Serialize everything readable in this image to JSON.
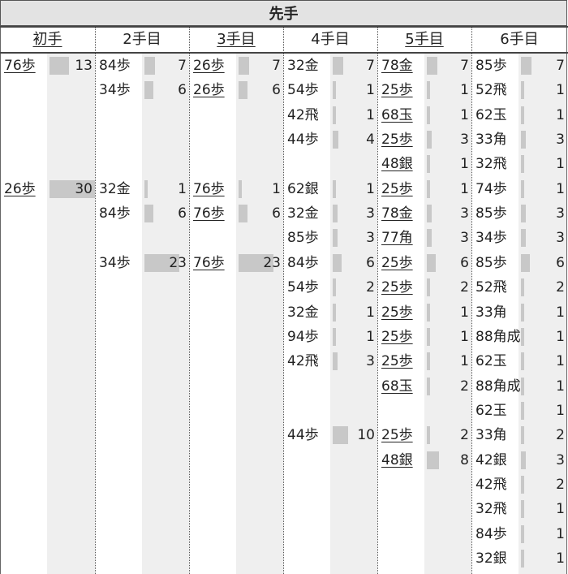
{
  "title": "先手",
  "max_count": 30,
  "columns": [
    {
      "label": "初手",
      "underline": true
    },
    {
      "label": "2手目",
      "underline": false
    },
    {
      "label": "3手目",
      "underline": true
    },
    {
      "label": "4手目",
      "underline": false
    },
    {
      "label": "5手目",
      "underline": true
    },
    {
      "label": "6手目",
      "underline": false
    }
  ],
  "cells": [
    {
      "row": 0,
      "col": 0,
      "move": "76歩",
      "underline": true,
      "count": 13
    },
    {
      "row": 0,
      "col": 1,
      "move": "84歩",
      "underline": false,
      "count": 7
    },
    {
      "row": 0,
      "col": 2,
      "move": "26歩",
      "underline": true,
      "count": 7
    },
    {
      "row": 0,
      "col": 3,
      "move": "32金",
      "underline": false,
      "count": 7
    },
    {
      "row": 0,
      "col": 4,
      "move": "78金",
      "underline": true,
      "count": 7
    },
    {
      "row": 0,
      "col": 5,
      "move": "85歩",
      "underline": false,
      "count": 7
    },
    {
      "row": 1,
      "col": 1,
      "move": "34歩",
      "underline": false,
      "count": 6
    },
    {
      "row": 1,
      "col": 2,
      "move": "26歩",
      "underline": true,
      "count": 6
    },
    {
      "row": 1,
      "col": 3,
      "move": "54歩",
      "underline": false,
      "count": 1
    },
    {
      "row": 1,
      "col": 4,
      "move": "25歩",
      "underline": true,
      "count": 1
    },
    {
      "row": 1,
      "col": 5,
      "move": "52飛",
      "underline": false,
      "count": 1
    },
    {
      "row": 2,
      "col": 3,
      "move": "42飛",
      "underline": false,
      "count": 1
    },
    {
      "row": 2,
      "col": 4,
      "move": "68玉",
      "underline": true,
      "count": 1
    },
    {
      "row": 2,
      "col": 5,
      "move": "62玉",
      "underline": false,
      "count": 1
    },
    {
      "row": 3,
      "col": 3,
      "move": "44歩",
      "underline": false,
      "count": 4
    },
    {
      "row": 3,
      "col": 4,
      "move": "25歩",
      "underline": true,
      "count": 3
    },
    {
      "row": 3,
      "col": 5,
      "move": "33角",
      "underline": false,
      "count": 3
    },
    {
      "row": 4,
      "col": 4,
      "move": "48銀",
      "underline": true,
      "count": 1
    },
    {
      "row": 4,
      "col": 5,
      "move": "32飛",
      "underline": false,
      "count": 1
    },
    {
      "row": 5,
      "col": 0,
      "move": "26歩",
      "underline": true,
      "count": 30
    },
    {
      "row": 5,
      "col": 1,
      "move": "32金",
      "underline": false,
      "count": 1
    },
    {
      "row": 5,
      "col": 2,
      "move": "76歩",
      "underline": true,
      "count": 1
    },
    {
      "row": 5,
      "col": 3,
      "move": "62銀",
      "underline": false,
      "count": 1
    },
    {
      "row": 5,
      "col": 4,
      "move": "25歩",
      "underline": true,
      "count": 1
    },
    {
      "row": 5,
      "col": 5,
      "move": "74歩",
      "underline": false,
      "count": 1
    },
    {
      "row": 6,
      "col": 1,
      "move": "84歩",
      "underline": false,
      "count": 6
    },
    {
      "row": 6,
      "col": 2,
      "move": "76歩",
      "underline": true,
      "count": 6
    },
    {
      "row": 6,
      "col": 3,
      "move": "32金",
      "underline": false,
      "count": 3
    },
    {
      "row": 6,
      "col": 4,
      "move": "78金",
      "underline": true,
      "count": 3
    },
    {
      "row": 6,
      "col": 5,
      "move": "85歩",
      "underline": false,
      "count": 3
    },
    {
      "row": 7,
      "col": 3,
      "move": "85歩",
      "underline": false,
      "count": 3
    },
    {
      "row": 7,
      "col": 4,
      "move": "77角",
      "underline": true,
      "count": 3
    },
    {
      "row": 7,
      "col": 5,
      "move": "34歩",
      "underline": false,
      "count": 3
    },
    {
      "row": 8,
      "col": 1,
      "move": "34歩",
      "underline": false,
      "count": 23
    },
    {
      "row": 8,
      "col": 2,
      "move": "76歩",
      "underline": true,
      "count": 23
    },
    {
      "row": 8,
      "col": 3,
      "move": "84歩",
      "underline": false,
      "count": 6
    },
    {
      "row": 8,
      "col": 4,
      "move": "25歩",
      "underline": true,
      "count": 6
    },
    {
      "row": 8,
      "col": 5,
      "move": "85歩",
      "underline": false,
      "count": 6
    },
    {
      "row": 9,
      "col": 3,
      "move": "54歩",
      "underline": false,
      "count": 2
    },
    {
      "row": 9,
      "col": 4,
      "move": "25歩",
      "underline": true,
      "count": 2
    },
    {
      "row": 9,
      "col": 5,
      "move": "52飛",
      "underline": false,
      "count": 2
    },
    {
      "row": 10,
      "col": 3,
      "move": "32金",
      "underline": false,
      "count": 1
    },
    {
      "row": 10,
      "col": 4,
      "move": "25歩",
      "underline": true,
      "count": 1
    },
    {
      "row": 10,
      "col": 5,
      "move": "33角",
      "underline": false,
      "count": 1
    },
    {
      "row": 11,
      "col": 3,
      "move": "94歩",
      "underline": false,
      "count": 1
    },
    {
      "row": 11,
      "col": 4,
      "move": "25歩",
      "underline": true,
      "count": 1
    },
    {
      "row": 11,
      "col": 5,
      "move": "88角成",
      "underline": false,
      "count": 1
    },
    {
      "row": 12,
      "col": 3,
      "move": "42飛",
      "underline": false,
      "count": 3
    },
    {
      "row": 12,
      "col": 4,
      "move": "25歩",
      "underline": true,
      "count": 1
    },
    {
      "row": 12,
      "col": 5,
      "move": "62玉",
      "underline": false,
      "count": 1
    },
    {
      "row": 13,
      "col": 4,
      "move": "68玉",
      "underline": true,
      "count": 2
    },
    {
      "row": 13,
      "col": 5,
      "move": "88角成",
      "underline": false,
      "count": 1
    },
    {
      "row": 14,
      "col": 5,
      "move": "62玉",
      "underline": false,
      "count": 1
    },
    {
      "row": 15,
      "col": 3,
      "move": "44歩",
      "underline": false,
      "count": 10
    },
    {
      "row": 15,
      "col": 4,
      "move": "25歩",
      "underline": true,
      "count": 2
    },
    {
      "row": 15,
      "col": 5,
      "move": "33角",
      "underline": false,
      "count": 2
    },
    {
      "row": 16,
      "col": 4,
      "move": "48銀",
      "underline": true,
      "count": 8
    },
    {
      "row": 16,
      "col": 5,
      "move": "42銀",
      "underline": false,
      "count": 3
    },
    {
      "row": 17,
      "col": 5,
      "move": "42飛",
      "underline": false,
      "count": 2
    },
    {
      "row": 18,
      "col": 5,
      "move": "32飛",
      "underline": false,
      "count": 1
    },
    {
      "row": 19,
      "col": 5,
      "move": "84歩",
      "underline": false,
      "count": 1
    },
    {
      "row": 20,
      "col": 5,
      "move": "32銀",
      "underline": false,
      "count": 1
    }
  ]
}
